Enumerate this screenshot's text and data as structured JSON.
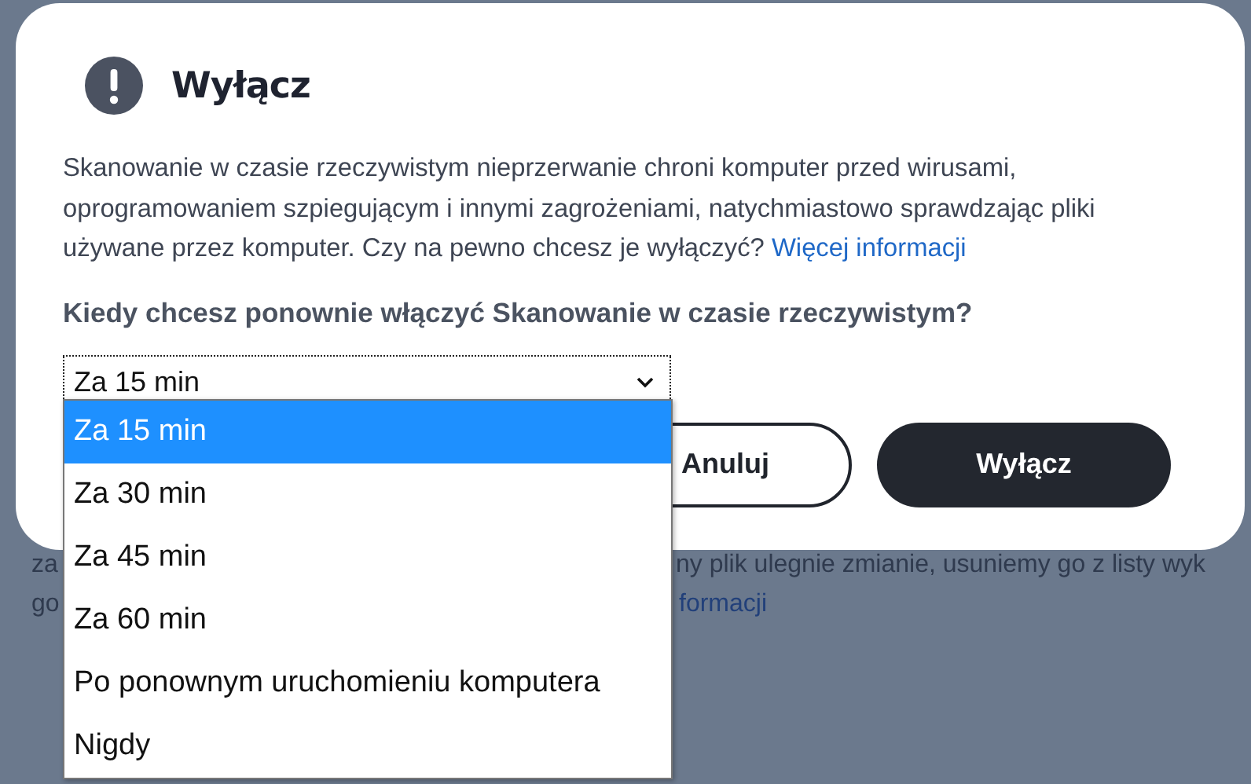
{
  "background": {
    "lines": [
      [
        {
          "text": "za",
          "kind": "text"
        },
        {
          "text": "ny plik ulegnie zmianie, usuniemy go z listy wyk",
          "kind": "text"
        }
      ],
      [
        {
          "text": "go",
          "kind": "text"
        },
        {
          "text": "formacji",
          "kind": "link"
        }
      ]
    ]
  },
  "dialog": {
    "title": "Wyłącz",
    "message": "Skanowanie w czasie rzeczywistym nieprzerwanie chroni komputer przed wirusami, oprogramowaniem szpiegującym i innymi zagrożeniami, natychmiastowo sprawdzając pliki używane przez komputer. Czy na pewno chcesz je wyłączyć?",
    "link": "Więcej informacji",
    "question": "Kiedy chcesz ponownie włączyć Skanowanie w czasie rzeczywistym?",
    "select": {
      "value": "Za 15 min",
      "expanded": true
    },
    "options": [
      {
        "label": "Za 15 min",
        "selected": true
      },
      {
        "label": "Za 30 min",
        "selected": false
      },
      {
        "label": "Za 45 min",
        "selected": false
      },
      {
        "label": "Za 60 min",
        "selected": false
      },
      {
        "label": "Po ponownym uruchomieniu komputera",
        "selected": false
      },
      {
        "label": "Nigdy",
        "selected": false
      }
    ],
    "buttons": [
      {
        "label": "Anuluj",
        "kind": "secondary"
      },
      {
        "label": "Wyłącz",
        "kind": "primary"
      }
    ]
  }
}
